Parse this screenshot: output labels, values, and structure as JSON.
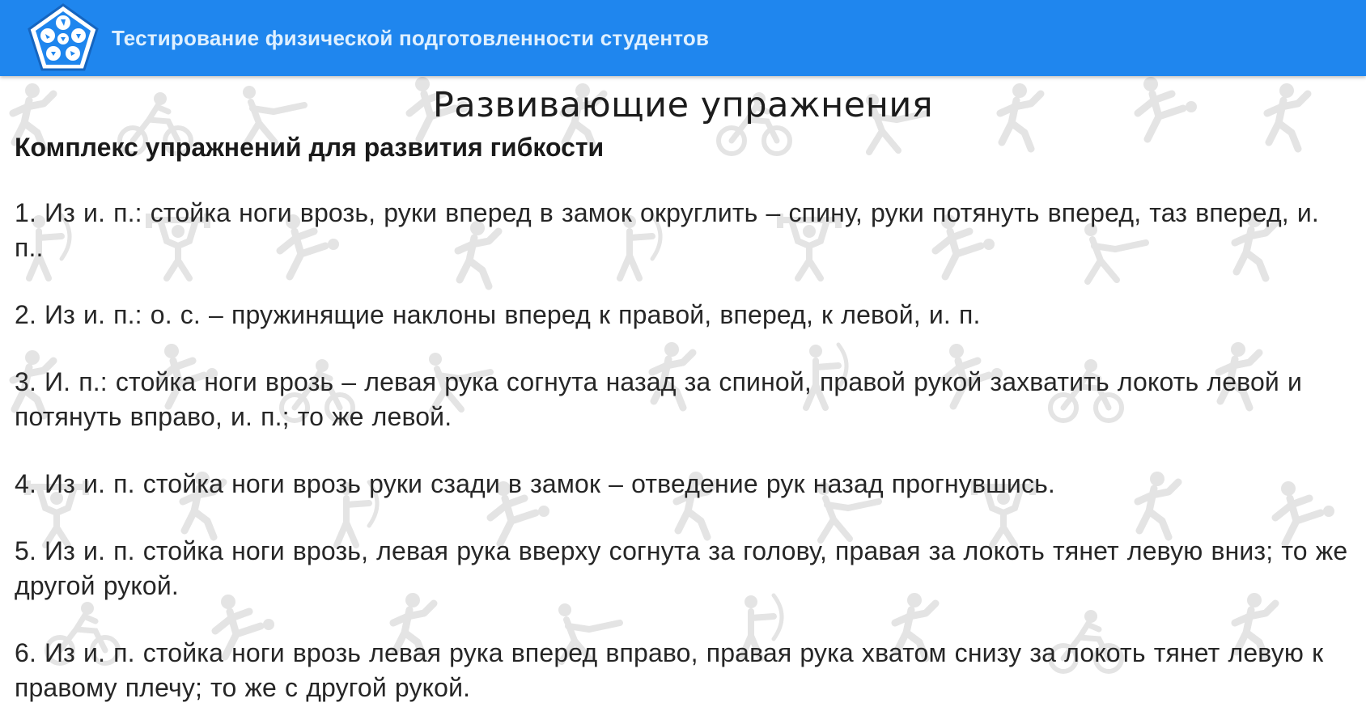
{
  "app_bar": {
    "title": "Тестирование физической подготовленности студентов",
    "logo_icon": "pentagon-sports-logo-icon",
    "background_color": "#1f86ee"
  },
  "page": {
    "title": "Развивающие упражнения",
    "section_title": "Комплекс упражнений для развития гибкости",
    "exercises": [
      {
        "text": "1. Из и. п.: стойка ноги врозь, руки вперед в замок округлить – спину, руки потянуть вперед, таз вперед, и. п.."
      },
      {
        "text": "2. Из и. п.: о. с. – пружинящие наклоны вперед к правой, вперед, к левой, и. п."
      },
      {
        "text": "3. И. п.: стойка ноги врозь – левая рука согнута назад за спиной, правой рукой захватить локоть левой и потянуть вправо, и. п.; то же левой."
      },
      {
        "text": "4. Из и. п. стойка ноги врозь руки сзади в замок – отведение рук назад прогнувшись."
      },
      {
        "text": "5. Из и. п. стойка ноги врозь, левая рука вверху согнута за голову, правая за локоть тянет левую вниз; то же другой рукой."
      },
      {
        "text": "6. Из и. п. стойка ноги врозь левая рука вперед вправо, правая рука хватом снизу за локоть тянет левую к правому плечу; то же с другой рукой."
      }
    ]
  },
  "background": {
    "pattern_icon": "sports-pictogram-pattern-icon",
    "pattern_color": "#e4e4e4"
  }
}
